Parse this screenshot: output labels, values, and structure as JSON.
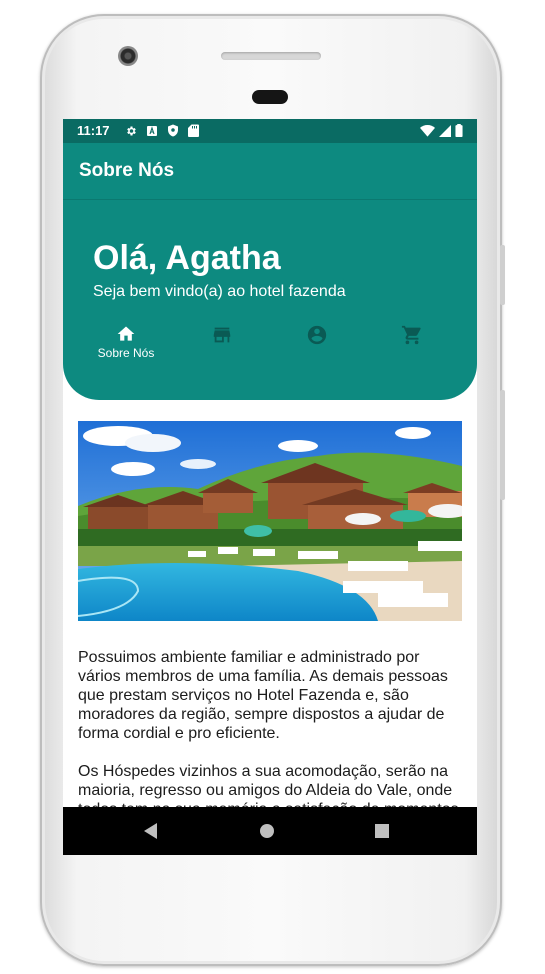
{
  "status": {
    "time": "11:17"
  },
  "appbar": {
    "title": "Sobre Nós"
  },
  "hero": {
    "greeting": "Olá, Agatha",
    "subtitle": "Seja bem vindo(a) ao hotel fazenda"
  },
  "nav": [
    {
      "label": "Sobre Nós",
      "icon": "home-icon",
      "active": true
    },
    {
      "label": "",
      "icon": "store-icon",
      "active": false
    },
    {
      "label": "",
      "icon": "account-circle-icon",
      "active": false
    },
    {
      "label": "",
      "icon": "shopping-cart-icon",
      "active": false
    }
  ],
  "content": {
    "paragraph1": "Possuimos ambiente familiar e administrado por vários membros de uma família. As demais pessoas que prestam serviços no Hotel Fazenda e, são moradores da região, sempre dispostos a ajudar de forma cordial e pro eficiente.",
    "paragraph2": "Os Hóspedes vizinhos a sua acomodação, serão na maioria, regresso ou amigos do Aldeia do Vale, onde todos tem na sua memória a satisfação de momentos vividos no hotel."
  },
  "colors": {
    "primary": "#0d8a80",
    "status_bar": "#0a6b63",
    "nav_icon_inactive": "#0a5a54"
  }
}
